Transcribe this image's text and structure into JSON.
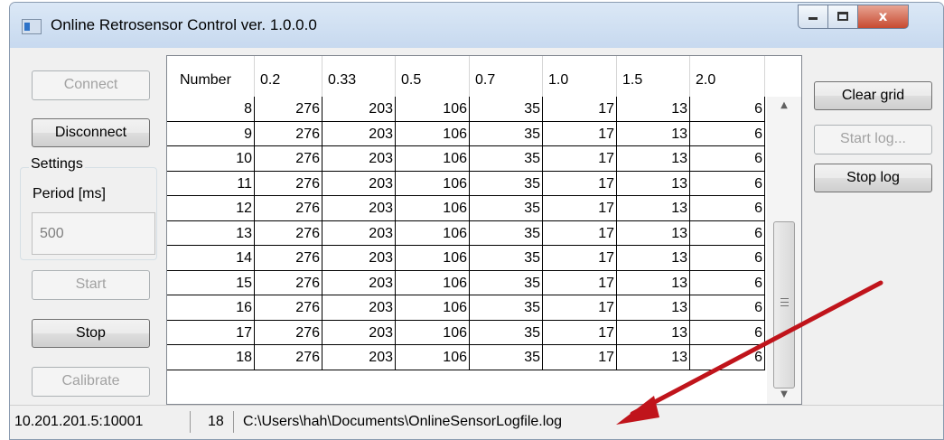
{
  "window": {
    "title": "Online Retrosensor Control ver. 1.0.0.0",
    "close_glyph": "x"
  },
  "left_panel": {
    "connect_label": "Connect",
    "disconnect_label": "Disconnect",
    "settings": {
      "legend": "Settings",
      "period_label": "Period [ms]",
      "period_value": "500"
    },
    "start_label": "Start",
    "stop_label": "Stop",
    "calibrate_label": "Calibrate"
  },
  "right_panel": {
    "clear_grid_label": "Clear grid",
    "start_log_label": "Start log...",
    "stop_log_label": "Stop log"
  },
  "grid": {
    "columns": [
      "Number",
      "0.2",
      "0.33",
      "0.5",
      "0.7",
      "1.0",
      "1.5",
      "2.0"
    ],
    "rows": [
      [
        "8",
        "276",
        "203",
        "106",
        "35",
        "17",
        "13",
        "6"
      ],
      [
        "9",
        "276",
        "203",
        "106",
        "35",
        "17",
        "13",
        "6"
      ],
      [
        "10",
        "276",
        "203",
        "106",
        "35",
        "17",
        "13",
        "6"
      ],
      [
        "11",
        "276",
        "203",
        "106",
        "35",
        "17",
        "13",
        "6"
      ],
      [
        "12",
        "276",
        "203",
        "106",
        "35",
        "17",
        "13",
        "6"
      ],
      [
        "13",
        "276",
        "203",
        "106",
        "35",
        "17",
        "13",
        "6"
      ],
      [
        "14",
        "276",
        "203",
        "106",
        "35",
        "17",
        "13",
        "6"
      ],
      [
        "15",
        "276",
        "203",
        "106",
        "35",
        "17",
        "13",
        "6"
      ],
      [
        "16",
        "276",
        "203",
        "106",
        "35",
        "17",
        "13",
        "6"
      ],
      [
        "17",
        "276",
        "203",
        "106",
        "35",
        "17",
        "13",
        "6"
      ],
      [
        "18",
        "276",
        "203",
        "106",
        "35",
        "17",
        "13",
        "6"
      ]
    ]
  },
  "statusbar": {
    "address": "10.201.201.5:10001",
    "count": "18",
    "log_path": "C:\\Users\\hah\\Documents\\OnlineSensorLogfile.log"
  },
  "colors": {
    "annotation_arrow": "#c0141b",
    "close_button": "#c74a30"
  },
  "icons": {
    "app": "app-window-icon",
    "minimize": "minimize-icon",
    "maximize": "maximize-icon",
    "close": "close-icon",
    "scroll_up": "scroll-up-arrow-icon",
    "scroll_down": "scroll-down-arrow-icon"
  }
}
